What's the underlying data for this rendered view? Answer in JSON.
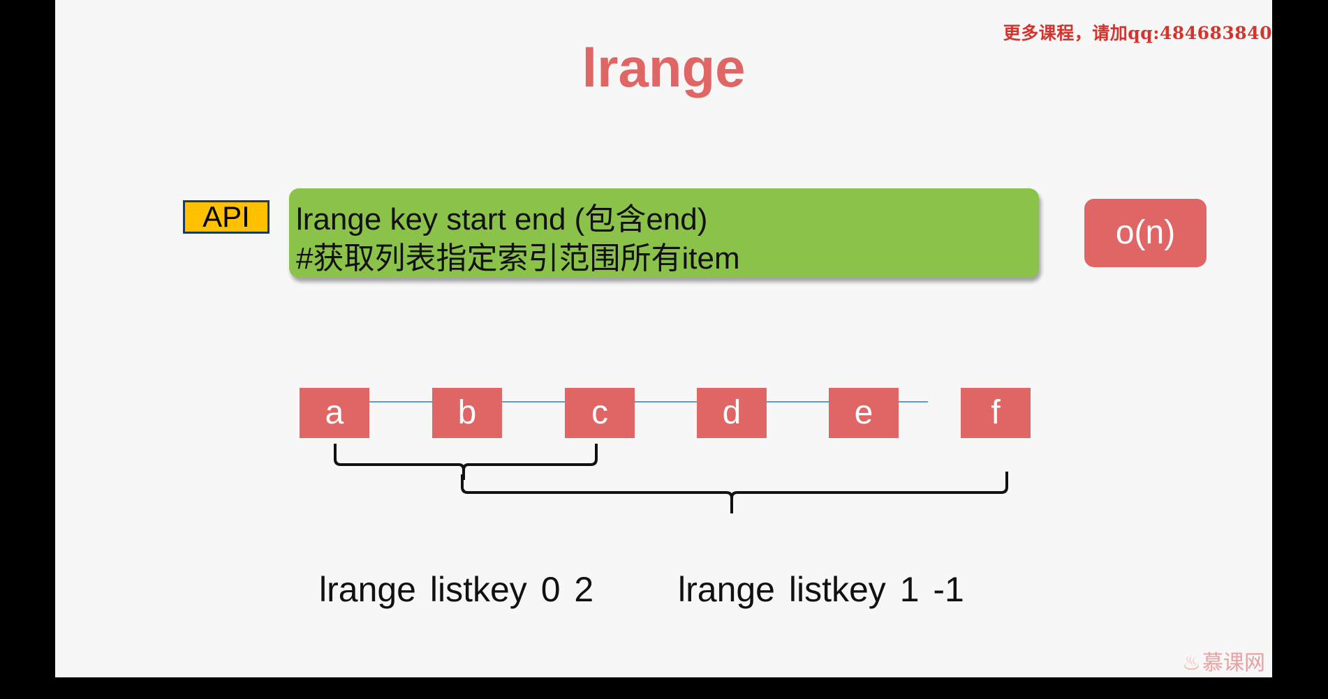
{
  "watermark": "更多课程，请加qq:484683840",
  "title": "lrange",
  "api": {
    "badge": "API",
    "line1": "lrange key start end (包含end)",
    "line2": "#获取列表指定索引范围所有item"
  },
  "complexity": "o(n)",
  "list": {
    "items": [
      "a",
      "b",
      "c",
      "d",
      "e",
      "f"
    ]
  },
  "examples": [
    "lrange  listkey 0 2",
    "lrange  listkey 1 -1"
  ],
  "logo": "慕课网",
  "colors": {
    "node": "#e06666",
    "api_box": "#8bc34a",
    "badge": "#ffc000",
    "link_line": "#5b9bd5"
  }
}
